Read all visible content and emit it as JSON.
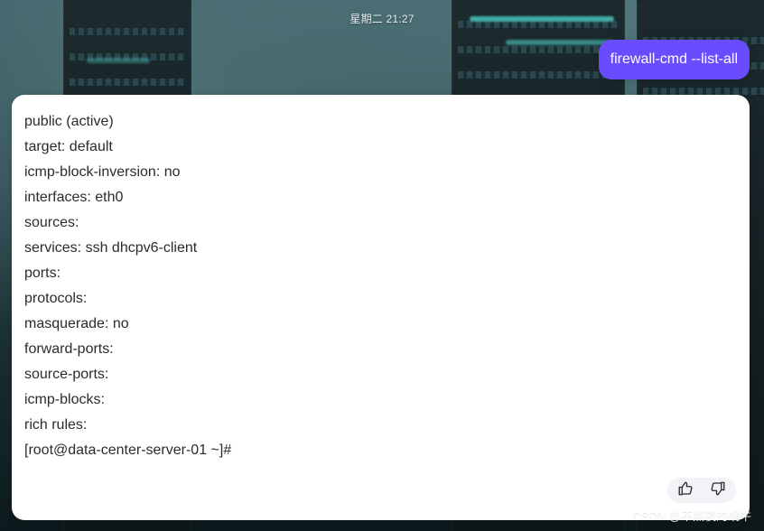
{
  "header": {
    "timestamp": "星期二 21:27"
  },
  "user_message": {
    "text": "firewall-cmd --list-all"
  },
  "response": {
    "lines": [
      "public (active)",
      "target: default",
      "icmp-block-inversion: no",
      "interfaces: eth0",
      "sources:",
      "services: ssh dhcpv6-client",
      "ports:",
      "protocols:",
      "masquerade: no",
      "forward-ports:",
      "source-ports:",
      "icmp-blocks:",
      "rich rules:",
      "[root@data-center-server-01 ~]#"
    ]
  },
  "feedback": {
    "like_icon": "thumbs-up-icon",
    "dislike_icon": "thumbs-down-icon"
  },
  "watermark": {
    "text": "CSDN @不熬夜的蜗牛"
  },
  "colors": {
    "user_bubble": "#6a4cff",
    "card_background": "#ffffff",
    "text": "#2b2b2b"
  }
}
